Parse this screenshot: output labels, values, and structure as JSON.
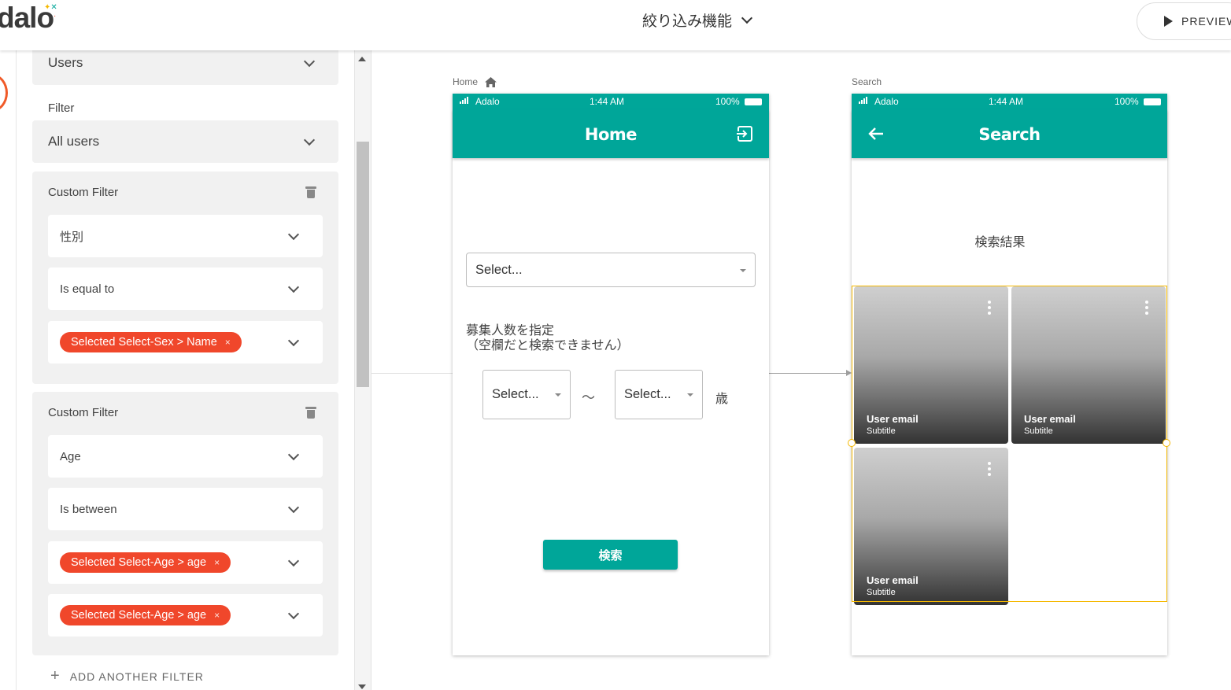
{
  "header": {
    "logo": "dalo",
    "app_title": "絞り込み機能",
    "preview_label": "PREVIEW"
  },
  "panel": {
    "collection_value": "Users",
    "filter_label": "Filter",
    "filter_value": "All users",
    "custom_filters": [
      {
        "title": "Custom Filter",
        "property": "性別",
        "operator": "Is equal to",
        "values": [
          "Selected Select-Sex > Name"
        ]
      },
      {
        "title": "Custom Filter",
        "property": "Age",
        "operator": "Is between",
        "values": [
          "Selected Select-Age > age",
          "Selected Select-Age > age"
        ]
      }
    ],
    "add_filter_label": "ADD ANOTHER FILTER"
  },
  "screens": {
    "home": {
      "label": "Home",
      "status_carrier": "Adalo",
      "status_time": "1:44 AM",
      "status_battery": "100%",
      "title": "Home",
      "select_placeholder": "Select...",
      "count_label_line1": "募集人数を指定",
      "count_label_line2": "（空欄だと検索できません）",
      "age_from_placeholder": "Select...",
      "tilde": "〜",
      "age_to_placeholder": "Select...",
      "age_unit": "歳",
      "search_button": "検索"
    },
    "search": {
      "label": "Search",
      "status_carrier": "Adalo",
      "status_time": "1:44 AM",
      "status_battery": "100%",
      "title": "Search",
      "results_label": "検索結果",
      "cards": [
        {
          "email": "User email",
          "subtitle": "Subtitle"
        },
        {
          "email": "User email",
          "subtitle": "Subtitle"
        },
        {
          "email": "User email",
          "subtitle": "Subtitle"
        }
      ]
    }
  },
  "colors": {
    "brand_teal": "#00a699",
    "chip_red": "#f0472b",
    "selection_yellow": "#f5b800"
  }
}
